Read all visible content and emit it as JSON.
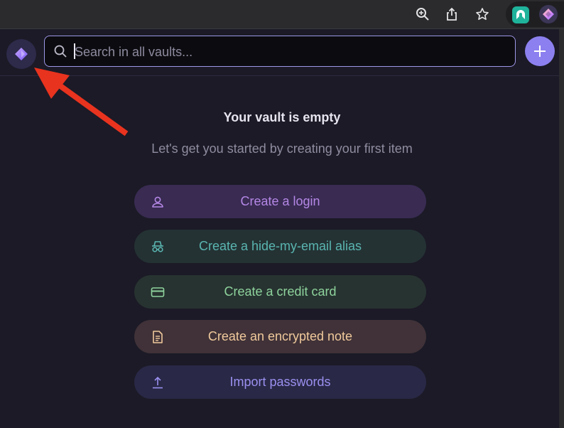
{
  "browser_toolbar": {
    "icons": [
      "zoom-icon",
      "share-icon",
      "star-icon"
    ],
    "extensions": [
      "proton-vpn-icon",
      "proton-pass-icon"
    ]
  },
  "header": {
    "menu_icon": "proton-pass-logo-icon",
    "search_placeholder": "Search in all vaults...",
    "add_icon": "plus-icon"
  },
  "empty_state": {
    "title": "Your vault is empty",
    "subtitle": "Let's get you started by creating your first item"
  },
  "actions": [
    {
      "label": "Create a login",
      "icon": "user-icon",
      "color": "#b487e6",
      "bg": "#392b52"
    },
    {
      "label": "Create a hide-my-email alias",
      "icon": "incognito-icon",
      "color": "#5ab5b0",
      "bg": "#243234"
    },
    {
      "label": "Create a credit card",
      "icon": "card-icon",
      "color": "#8ed39d",
      "bg": "#273330"
    },
    {
      "label": "Create an encrypted note",
      "icon": "note-icon",
      "color": "#f0c99c",
      "bg": "#403238"
    },
    {
      "label": "Import passwords",
      "icon": "upload-icon",
      "color": "#9a90f0",
      "bg": "#292846"
    }
  ],
  "colors": {
    "background": "#1b1a26",
    "accent": "#8c80f0",
    "annotation_arrow": "#e8331f"
  }
}
